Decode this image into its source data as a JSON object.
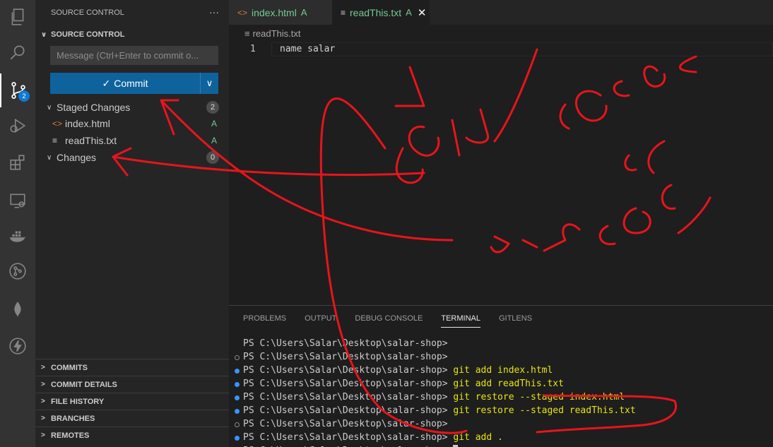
{
  "activity_bar": {
    "items": [
      {
        "name": "explorer-icon"
      },
      {
        "name": "search-icon"
      },
      {
        "name": "source-control-icon",
        "badge": "2"
      },
      {
        "name": "run-debug-icon"
      },
      {
        "name": "extensions-icon"
      },
      {
        "name": "remote-explorer-icon"
      },
      {
        "name": "docker-icon"
      },
      {
        "name": "gitlens-icon"
      },
      {
        "name": "mongodb-icon"
      },
      {
        "name": "thunder-client-icon"
      }
    ]
  },
  "sidebar": {
    "title": "SOURCE CONTROL",
    "more": "···",
    "section_title": "SOURCE CONTROL",
    "message_placeholder": "Message (Ctrl+Enter to commit o...",
    "commit_label": "Commit",
    "staged": {
      "label": "Staged Changes",
      "count": "2"
    },
    "staged_files": [
      {
        "name": "index.html",
        "status": "A"
      },
      {
        "name": "readThis.txt",
        "status": "A"
      }
    ],
    "changes": {
      "label": "Changes",
      "count": "0"
    },
    "bottom_sections": [
      "COMMITS",
      "COMMIT DETAILS",
      "FILE HISTORY",
      "BRANCHES",
      "REMOTES"
    ]
  },
  "editor": {
    "tabs": [
      {
        "label": "index.html",
        "status": "A"
      },
      {
        "label": "readThis.txt",
        "status": "A"
      }
    ],
    "breadcrumb": "readThis.txt",
    "lines": [
      {
        "number": "1",
        "text": "name salar"
      }
    ]
  },
  "panel": {
    "tabs": [
      "PROBLEMS",
      "OUTPUT",
      "DEBUG CONSOLE",
      "TERMINAL",
      "GITLENS"
    ],
    "active_tab": "TERMINAL",
    "prompt": "PS C:\\Users\\Salar\\Desktop\\salar-shop>",
    "terminal_lines": [
      {
        "marker": "none",
        "command": ""
      },
      {
        "marker": "hollow",
        "command": ""
      },
      {
        "marker": "blue",
        "command": "git add index.html"
      },
      {
        "marker": "blue",
        "command": "git add readThis.txt"
      },
      {
        "marker": "blue",
        "command": "git restore --staged index.html"
      },
      {
        "marker": "blue",
        "command": "git restore --staged readThis.txt"
      },
      {
        "marker": "hollow",
        "command": ""
      },
      {
        "marker": "blue",
        "command": "git add ."
      },
      {
        "marker": "hollow",
        "command": ""
      }
    ]
  },
  "colors": {
    "accent_blue": "#0e639c",
    "added_green": "#73c991",
    "annotation_red": "#e8141c"
  }
}
